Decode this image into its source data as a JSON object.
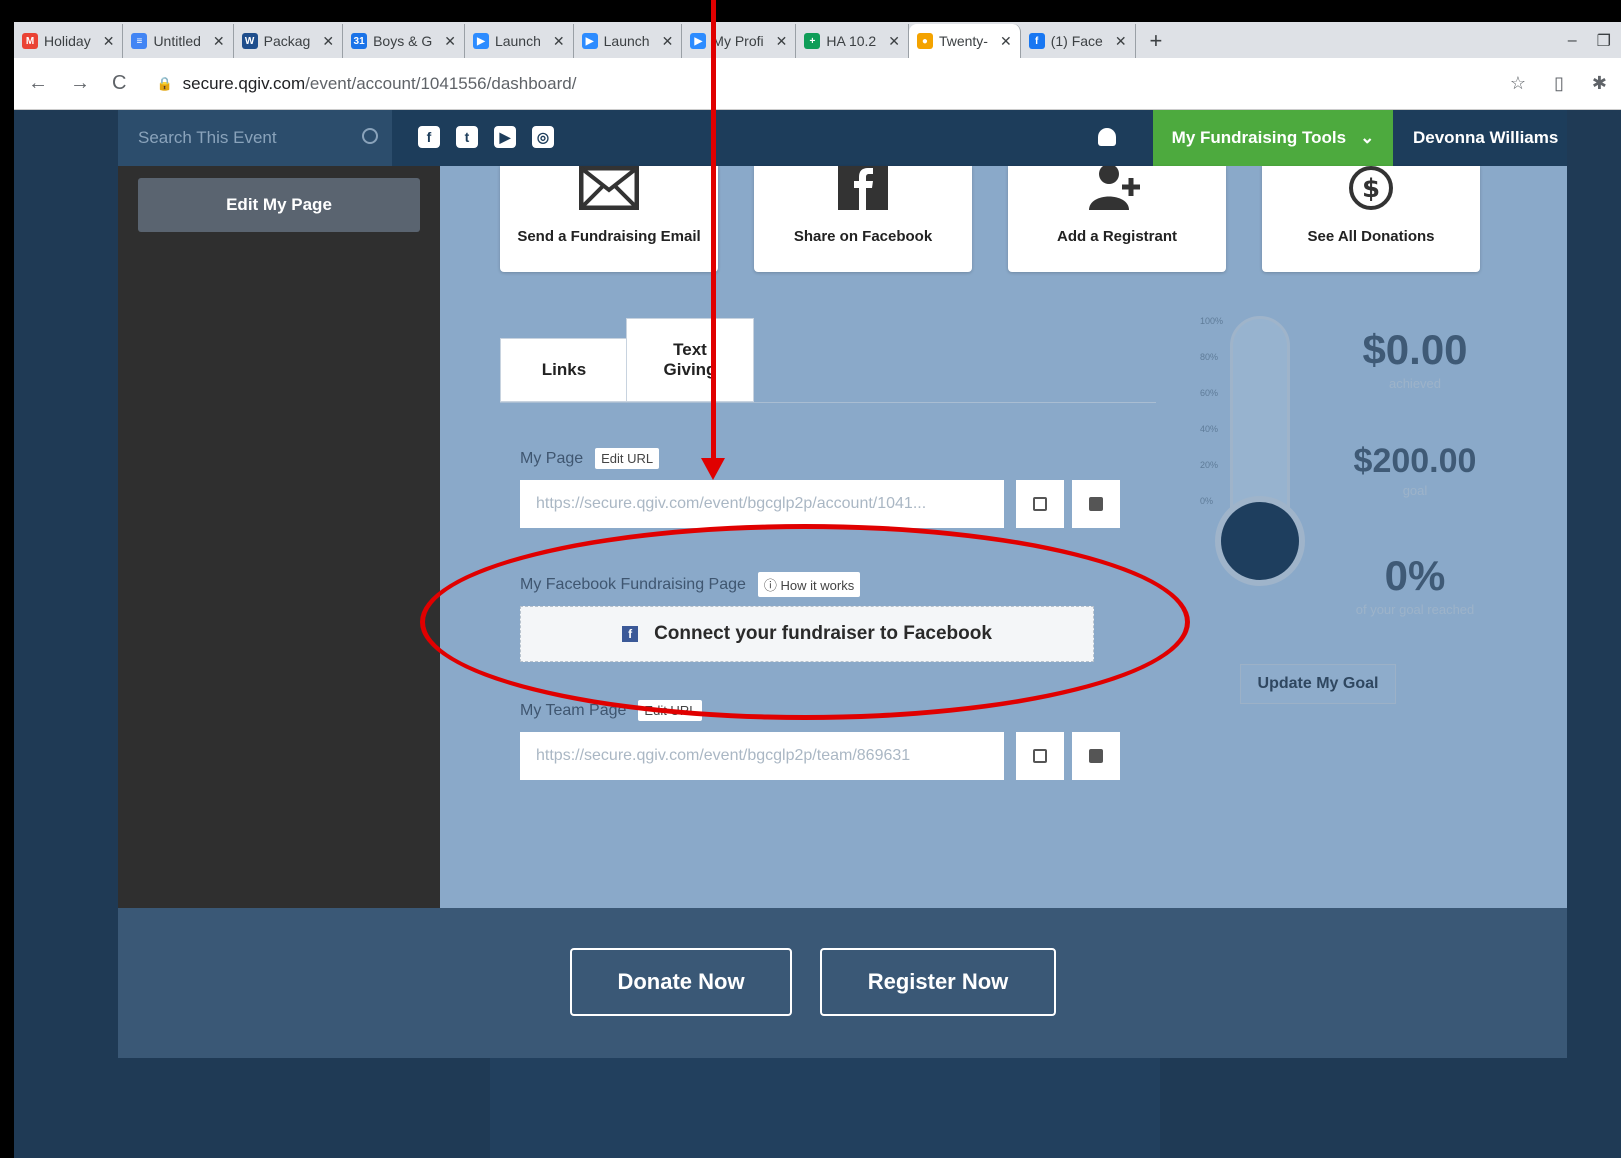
{
  "browser": {
    "tabs": [
      {
        "label": "Holiday",
        "icon": "gmail-icon",
        "color": "#ea4335"
      },
      {
        "label": "Untitled",
        "icon": "docs-icon",
        "color": "#4285f4"
      },
      {
        "label": "Packag",
        "icon": "w-icon",
        "color": "#1f4e8c"
      },
      {
        "label": "Boys & G",
        "icon": "calendar-icon",
        "color": "#1a73e8"
      },
      {
        "label": "Launch",
        "icon": "zoom-icon",
        "color": "#2d8cff"
      },
      {
        "label": "Launch",
        "icon": "zoom-icon",
        "color": "#2d8cff"
      },
      {
        "label": "My Profi",
        "icon": "zoom-icon",
        "color": "#2d8cff"
      },
      {
        "label": "HA 10.2",
        "icon": "sheets-icon",
        "color": "#0f9d58"
      },
      {
        "label": "Twenty-",
        "icon": "qgiv-icon",
        "color": "#f4a300"
      },
      {
        "label": "(1) Face",
        "icon": "facebook-icon",
        "color": "#1877f2"
      }
    ],
    "url_host": "secure.qgiv.com",
    "url_path": "/event/account/1041556/dashboard/"
  },
  "site": {
    "search_placeholder": "Search This Event",
    "tools_label": "My Fundraising Tools",
    "user_name": "Devonna Williams",
    "edit_my_page": "Edit My Page"
  },
  "cards": [
    {
      "label": "Send a Fundraising Email",
      "icon": "envelope-icon"
    },
    {
      "label": "Share on Facebook",
      "icon": "facebook-icon"
    },
    {
      "label": "Add a Registrant",
      "icon": "add-user-icon"
    },
    {
      "label": "See All Donations",
      "icon": "dollar-icon"
    }
  ],
  "tabs": {
    "links": "Links",
    "text_giving": "Text Giving"
  },
  "my_page": {
    "label": "My Page",
    "edit": "Edit URL",
    "url": "https://secure.qgiv.com/event/bgcglp2p/account/1041..."
  },
  "facebook": {
    "label": "My Facebook Fundraising Page",
    "how": "How it works",
    "button": "Connect your fundraiser to Facebook"
  },
  "team_page": {
    "label": "My Team Page",
    "edit": "Edit URL",
    "url": "https://secure.qgiv.com/event/bgcglp2p/team/869631"
  },
  "stats": {
    "achieved": "$0.00",
    "achieved_label": "achieved",
    "goal": "$200.00",
    "goal_label": "goal",
    "percent": "0%",
    "percent_label": "of your goal reached",
    "update_goal": "Update My Goal"
  },
  "thermometer_ticks": [
    "100%",
    "80%",
    "60%",
    "40%",
    "20%",
    "0%"
  ],
  "footer": {
    "donate": "Donate Now",
    "register": "Register Now"
  }
}
